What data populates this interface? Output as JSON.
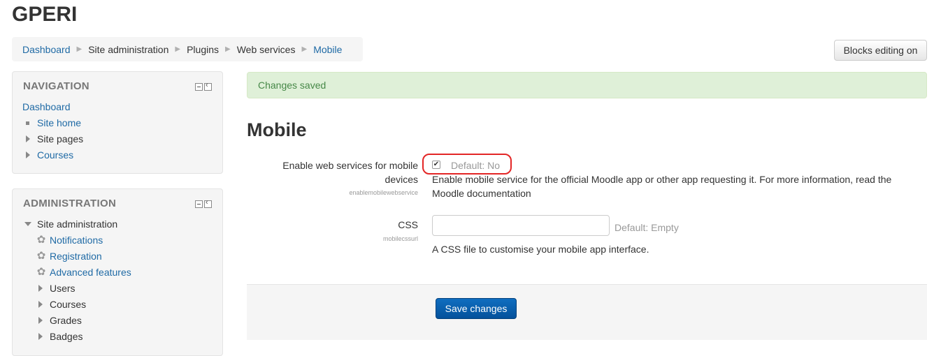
{
  "site": {
    "title": "GPERI"
  },
  "breadcrumb": [
    {
      "label": "Dashboard",
      "link": true
    },
    {
      "label": "Site administration",
      "link": false
    },
    {
      "label": "Plugins",
      "link": false
    },
    {
      "label": "Web services",
      "link": false
    },
    {
      "label": "Mobile",
      "link": true
    }
  ],
  "header": {
    "blocks_editing_label": "Blocks editing on"
  },
  "navigation": {
    "title": "NAVIGATION",
    "items": [
      {
        "label": "Dashboard",
        "link": true,
        "marker": "none"
      },
      {
        "label": "Site home",
        "link": true,
        "marker": "bullet"
      },
      {
        "label": "Site pages",
        "link": false,
        "marker": "collapsed"
      },
      {
        "label": "Courses",
        "link": true,
        "marker": "collapsed"
      }
    ]
  },
  "administration": {
    "title": "ADMINISTRATION",
    "root": {
      "label": "Site administration",
      "marker": "expanded"
    },
    "items": [
      {
        "label": "Notifications",
        "link": true,
        "marker": "gear"
      },
      {
        "label": "Registration",
        "link": true,
        "marker": "gear"
      },
      {
        "label": "Advanced features",
        "link": true,
        "marker": "gear"
      },
      {
        "label": "Users",
        "link": false,
        "marker": "collapsed"
      },
      {
        "label": "Courses",
        "link": false,
        "marker": "collapsed"
      },
      {
        "label": "Grades",
        "link": false,
        "marker": "collapsed"
      },
      {
        "label": "Badges",
        "link": false,
        "marker": "collapsed"
      }
    ]
  },
  "alert": {
    "message": "Changes saved"
  },
  "page": {
    "heading": "Mobile"
  },
  "settings": {
    "enable_ws": {
      "label_line1": "Enable web services for mobile",
      "label_line2": "devices",
      "key": "enablemobilewebservice",
      "checked": true,
      "default_text": "Default: No",
      "description": "Enable mobile service for the official Moodle app or other app requesting it. For more information, read the",
      "doc_link": "Moodle documentation"
    },
    "css": {
      "label": "CSS",
      "key": "mobilecssurl",
      "value": "",
      "default_text": "Default: Empty",
      "description": "A CSS file to customise your mobile app interface."
    }
  },
  "footer": {
    "save_label": "Save changes"
  },
  "colors": {
    "link": "#1f6aa5",
    "alert_bg": "#dff0d8",
    "alert_text": "#468847",
    "primary_button": "#0a5ea8",
    "highlight": "#e32626"
  }
}
